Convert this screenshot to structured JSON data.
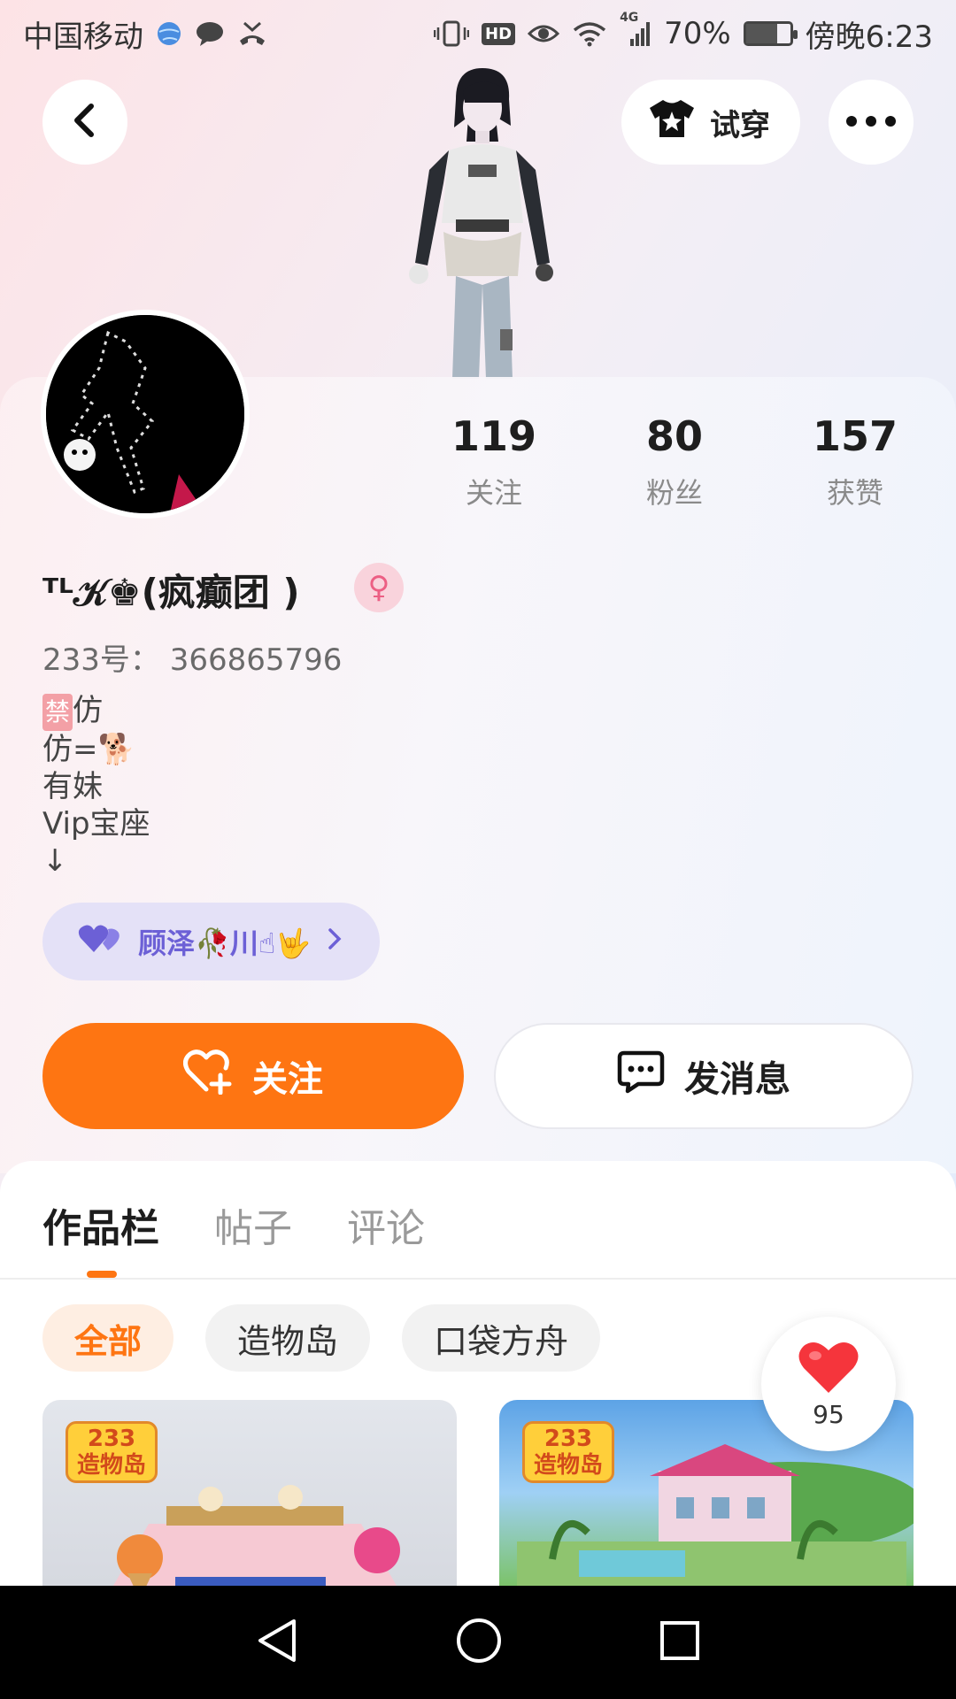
{
  "status_bar": {
    "carrier": "中国移动",
    "network": "4G",
    "battery": "70%",
    "time": "傍晚6:23",
    "hd": "HD"
  },
  "header": {
    "try_on_label": "试穿"
  },
  "profile": {
    "stats": [
      {
        "value": "119",
        "label": "关注"
      },
      {
        "value": "80",
        "label": "粉丝"
      },
      {
        "value": "157",
        "label": "获赞"
      }
    ],
    "username": "ᵀᴸ𝒦♚(疯癫团 )",
    "gender_icon": "♀",
    "uid": "233号：  366865796",
    "bio_prefix": "禁",
    "bio_lines": [
      "仿",
      "仿=🐕",
      "有妹",
      "Vip宝座",
      "↓"
    ],
    "friend": {
      "name": "顾泽🥀川☝🤟"
    }
  },
  "actions": {
    "follow_label": "关注",
    "message_label": "发消息"
  },
  "tabs": [
    "作品栏",
    "帖子",
    "评论"
  ],
  "filters": [
    "全部",
    "造物岛",
    "口袋方舟"
  ],
  "works": [
    {
      "logo_line1": "233",
      "logo_line2": "造物岛"
    },
    {
      "logo_line1": "233",
      "logo_line2": "造物岛"
    }
  ],
  "like_bubble": {
    "count": "95"
  },
  "colors": {
    "accent": "#fe7512",
    "friend_purple": "#6c60d6"
  }
}
